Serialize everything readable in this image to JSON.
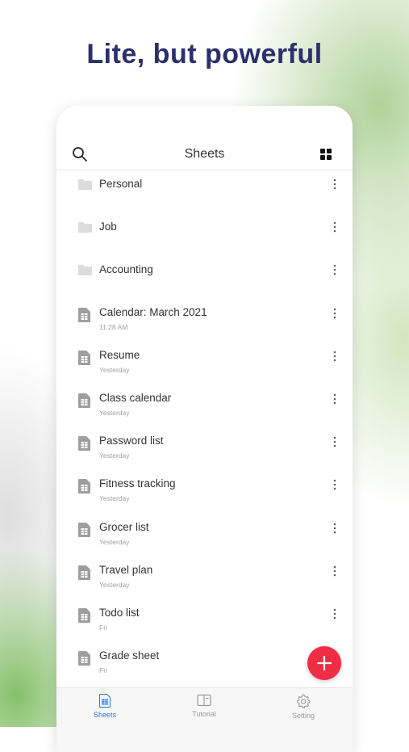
{
  "headline": "Lite, but powerful",
  "header": {
    "title": "Sheets"
  },
  "items": [
    {
      "type": "folder",
      "name": "Personal"
    },
    {
      "type": "folder",
      "name": "Job"
    },
    {
      "type": "folder",
      "name": "Accounting"
    },
    {
      "type": "file",
      "name": "Calendar: March 2021",
      "date": "11:28 AM"
    },
    {
      "type": "file",
      "name": "Resume",
      "date": "Yesterday"
    },
    {
      "type": "file",
      "name": "Class calendar",
      "date": "Yesterday"
    },
    {
      "type": "file",
      "name": "Password list",
      "date": "Yesterday"
    },
    {
      "type": "file",
      "name": "Fitness tracking",
      "date": "Yesterday"
    },
    {
      "type": "file",
      "name": "Grocer list",
      "date": "Yesterday"
    },
    {
      "type": "file",
      "name": "Travel plan",
      "date": "Yesterday"
    },
    {
      "type": "file",
      "name": "Todo list",
      "date": "Fri"
    },
    {
      "type": "file",
      "name": "Grade sheet",
      "date": "Fri"
    }
  ],
  "tabs": [
    {
      "label": "Sheets",
      "active": true
    },
    {
      "label": "Tutorial",
      "active": false
    },
    {
      "label": "Setting",
      "active": false
    }
  ],
  "colors": {
    "headline": "#2b2f6b",
    "fab": "#ef2e45",
    "active_tab": "#2d7be8",
    "icon_gray": "#9e9e9e"
  }
}
